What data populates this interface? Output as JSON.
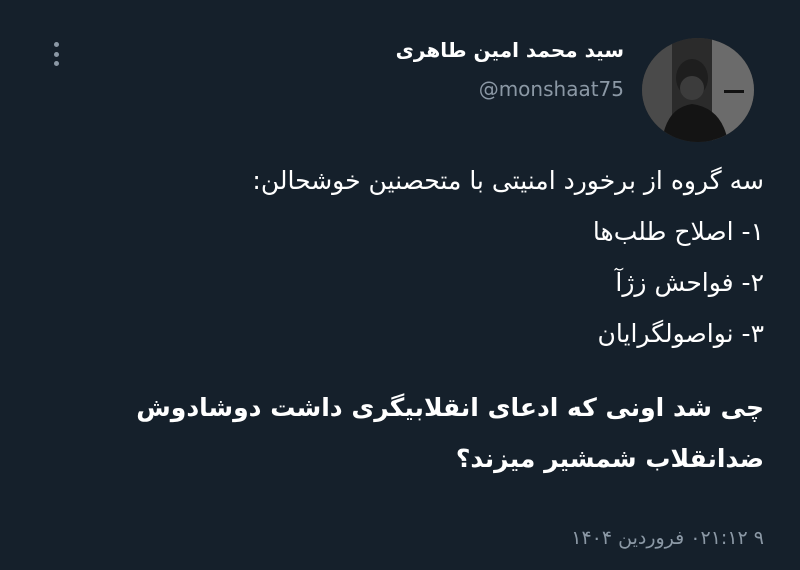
{
  "author": {
    "display_name": "سید محمد امین طاهری",
    "handle": "@monshaat75"
  },
  "tweet": {
    "lines": [
      "سه گروه از برخورد امنیتی با متحصنین خوشحالن:",
      "۱- اصلاح طلب‌ها",
      "۲- فواحش زژآ",
      "۳- نواصولگرایان"
    ],
    "emphasis_lines": [
      "چی شد اونی که ادعای انقلابیگری داشت دوشادوش",
      "ضدانقلاب شمشیر میزند؟"
    ],
    "timestamp": "۹ ۰۲۱:۱۲ فروردین ۱۴۰۴"
  },
  "icons": {
    "more": "more-vertical-icon"
  },
  "colors": {
    "background": "#15202b",
    "text_primary": "#ffffff",
    "text_secondary": "#8b98a5"
  }
}
